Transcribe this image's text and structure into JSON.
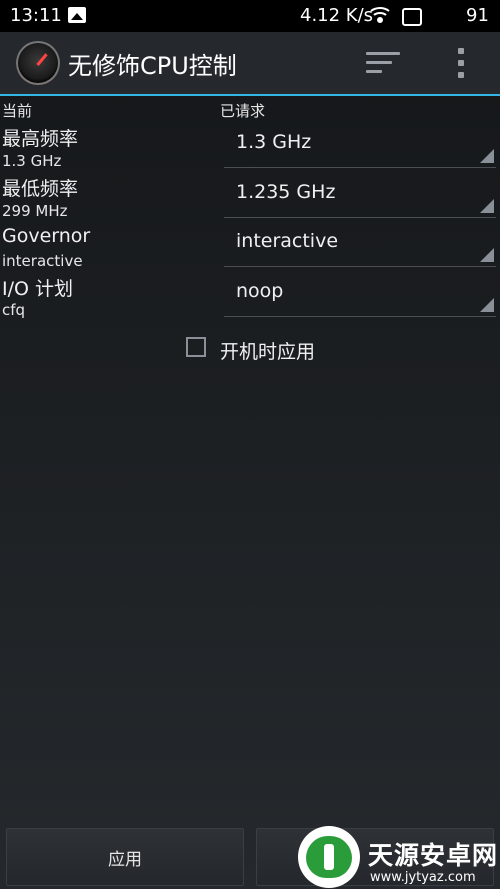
{
  "status_bar": {
    "time": "13:11",
    "network_speed": "4.12 K/s",
    "battery": "91"
  },
  "app_bar": {
    "title": "无修饰CPU控制"
  },
  "columns": {
    "current_header": "当前",
    "requested_header": "已请求"
  },
  "settings": [
    {
      "label": "最高频率",
      "current": "1.3 GHz",
      "requested": "1.3 GHz"
    },
    {
      "label": "最低频率",
      "current": "299 MHz",
      "requested": "1.235 GHz"
    },
    {
      "label": "Governor",
      "current": "interactive",
      "requested": "interactive"
    },
    {
      "label": "I/O 计划",
      "current": "cfq",
      "requested": "noop"
    }
  ],
  "apply_on_boot": {
    "label": "开机时应用",
    "checked": false
  },
  "buttons": {
    "apply": "应用"
  },
  "watermark": {
    "name": "天源安卓网",
    "url": "www.jytyaz.com"
  }
}
